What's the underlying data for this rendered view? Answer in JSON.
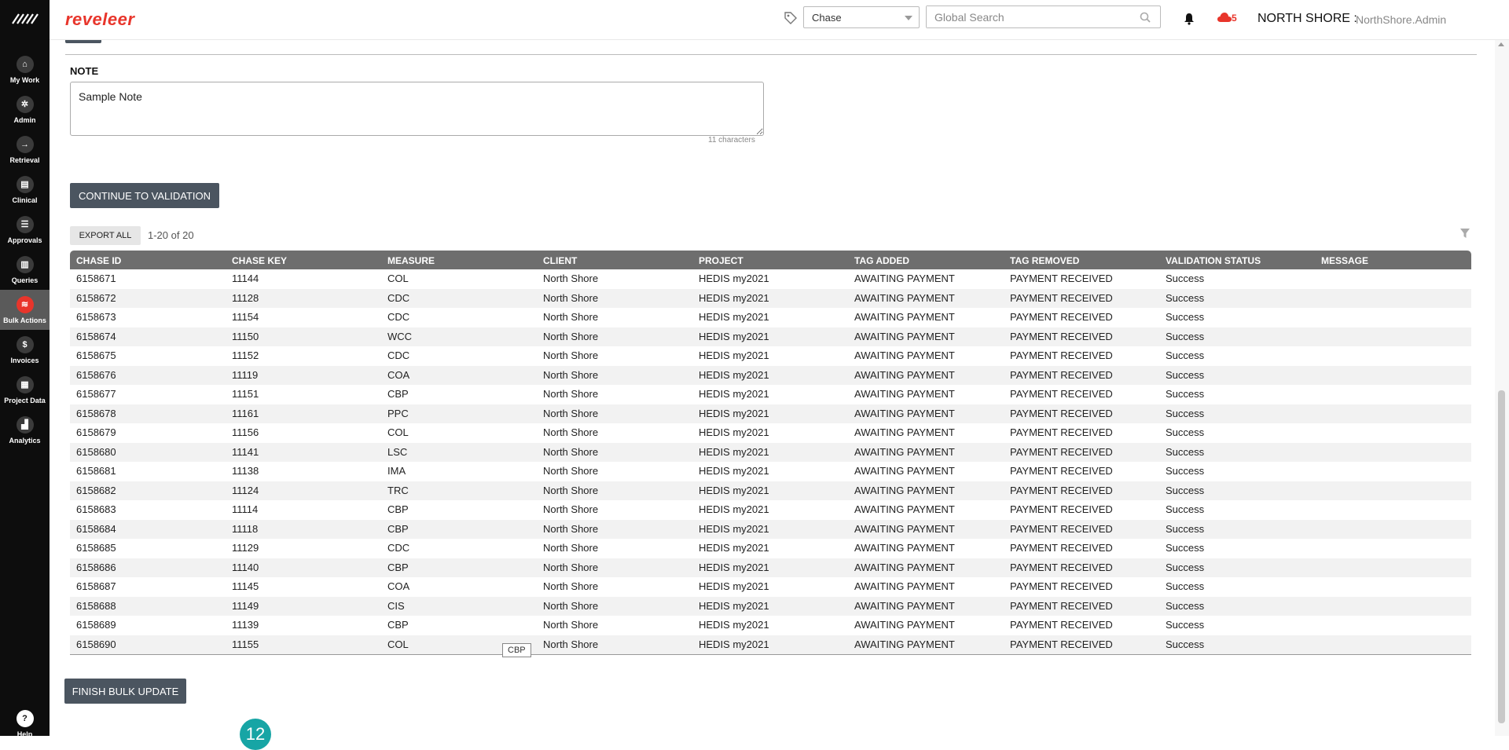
{
  "brand": "reveleer",
  "sidebar": {
    "items": [
      {
        "label": "My Work",
        "icon": "home-icon",
        "glyph": "⌂"
      },
      {
        "label": "Admin",
        "icon": "gear-icon",
        "glyph": "✲"
      },
      {
        "label": "Retrieval",
        "icon": "arrow-right-icon",
        "glyph": "→"
      },
      {
        "label": "Clinical",
        "icon": "clipboard-icon",
        "glyph": "▤"
      },
      {
        "label": "Approvals",
        "icon": "list-icon",
        "glyph": "☰"
      },
      {
        "label": "Queries",
        "icon": "inbox-icon",
        "glyph": "▥"
      },
      {
        "label": "Bulk Actions",
        "icon": "layers-icon",
        "glyph": "≋",
        "active": true
      },
      {
        "label": "Invoices",
        "icon": "dollar-icon",
        "glyph": "$"
      },
      {
        "label": "Project Data",
        "icon": "grid-icon",
        "glyph": "▦"
      },
      {
        "label": "Analytics",
        "icon": "chart-icon",
        "glyph": "▟"
      }
    ],
    "help": {
      "label": "Help",
      "glyph": "?"
    }
  },
  "header": {
    "select_value": "Chase",
    "search_placeholder": "Global Search",
    "cloud_count": "5",
    "org": "NORTH SHORE :",
    "user": "NorthShore.Admin"
  },
  "note": {
    "label": "NOTE",
    "value": "Sample Note",
    "char_count": "11 characters"
  },
  "buttons": {
    "continue": "CONTINUE TO VALIDATION",
    "export_all": "EXPORT ALL",
    "finish": "FINISH BULK UPDATE"
  },
  "paging": "1-20  of  20",
  "table": {
    "columns": [
      "CHASE ID",
      "CHASE KEY",
      "MEASURE",
      "CLIENT",
      "PROJECT",
      "TAG ADDED",
      "TAG REMOVED",
      "VALIDATION STATUS",
      "MESSAGE"
    ],
    "rows": [
      [
        "6158671",
        "11144",
        "COL",
        "North Shore",
        "HEDIS my2021",
        "AWAITING PAYMENT",
        "PAYMENT RECEIVED",
        "Success",
        ""
      ],
      [
        "6158672",
        "11128",
        "CDC",
        "North Shore",
        "HEDIS my2021",
        "AWAITING PAYMENT",
        "PAYMENT RECEIVED",
        "Success",
        ""
      ],
      [
        "6158673",
        "11154",
        "CDC",
        "North Shore",
        "HEDIS my2021",
        "AWAITING PAYMENT",
        "PAYMENT RECEIVED",
        "Success",
        ""
      ],
      [
        "6158674",
        "11150",
        "WCC",
        "North Shore",
        "HEDIS my2021",
        "AWAITING PAYMENT",
        "PAYMENT RECEIVED",
        "Success",
        ""
      ],
      [
        "6158675",
        "11152",
        "CDC",
        "North Shore",
        "HEDIS my2021",
        "AWAITING PAYMENT",
        "PAYMENT RECEIVED",
        "Success",
        ""
      ],
      [
        "6158676",
        "11119",
        "COA",
        "North Shore",
        "HEDIS my2021",
        "AWAITING PAYMENT",
        "PAYMENT RECEIVED",
        "Success",
        ""
      ],
      [
        "6158677",
        "11151",
        "CBP",
        "North Shore",
        "HEDIS my2021",
        "AWAITING PAYMENT",
        "PAYMENT RECEIVED",
        "Success",
        ""
      ],
      [
        "6158678",
        "11161",
        "PPC",
        "North Shore",
        "HEDIS my2021",
        "AWAITING PAYMENT",
        "PAYMENT RECEIVED",
        "Success",
        ""
      ],
      [
        "6158679",
        "11156",
        "COL",
        "North Shore",
        "HEDIS my2021",
        "AWAITING PAYMENT",
        "PAYMENT RECEIVED",
        "Success",
        ""
      ],
      [
        "6158680",
        "11141",
        "LSC",
        "North Shore",
        "HEDIS my2021",
        "AWAITING PAYMENT",
        "PAYMENT RECEIVED",
        "Success",
        ""
      ],
      [
        "6158681",
        "11138",
        "IMA",
        "North Shore",
        "HEDIS my2021",
        "AWAITING PAYMENT",
        "PAYMENT RECEIVED",
        "Success",
        ""
      ],
      [
        "6158682",
        "11124",
        "TRC",
        "North Shore",
        "HEDIS my2021",
        "AWAITING PAYMENT",
        "PAYMENT RECEIVED",
        "Success",
        ""
      ],
      [
        "6158683",
        "11114",
        "CBP",
        "North Shore",
        "HEDIS my2021",
        "AWAITING PAYMENT",
        "PAYMENT RECEIVED",
        "Success",
        ""
      ],
      [
        "6158684",
        "11118",
        "CBP",
        "North Shore",
        "HEDIS my2021",
        "AWAITING PAYMENT",
        "PAYMENT RECEIVED",
        "Success",
        ""
      ],
      [
        "6158685",
        "11129",
        "CDC",
        "North Shore",
        "HEDIS my2021",
        "AWAITING PAYMENT",
        "PAYMENT RECEIVED",
        "Success",
        ""
      ],
      [
        "6158686",
        "11140",
        "CBP",
        "North Shore",
        "HEDIS my2021",
        "AWAITING PAYMENT",
        "PAYMENT RECEIVED",
        "Success",
        ""
      ],
      [
        "6158687",
        "11145",
        "COA",
        "North Shore",
        "HEDIS my2021",
        "AWAITING PAYMENT",
        "PAYMENT RECEIVED",
        "Success",
        ""
      ],
      [
        "6158688",
        "11149",
        "CIS",
        "North Shore",
        "HEDIS my2021",
        "AWAITING PAYMENT",
        "PAYMENT RECEIVED",
        "Success",
        ""
      ],
      [
        "6158689",
        "11139",
        "CBP",
        "North Shore",
        "HEDIS my2021",
        "AWAITING PAYMENT",
        "PAYMENT RECEIVED",
        "Success",
        ""
      ],
      [
        "6158690",
        "11155",
        "COL",
        "North Shore",
        "HEDIS my2021",
        "AWAITING PAYMENT",
        "PAYMENT RECEIVED",
        "Success",
        ""
      ]
    ]
  },
  "tooltip": "CBP",
  "step_badge": "12",
  "colors": {
    "brand": "#e8352b",
    "sidebar_bg": "#0d0d0d",
    "button_dark": "#4b5560",
    "table_header": "#6e6e6e",
    "badge": "#17a5a5"
  }
}
